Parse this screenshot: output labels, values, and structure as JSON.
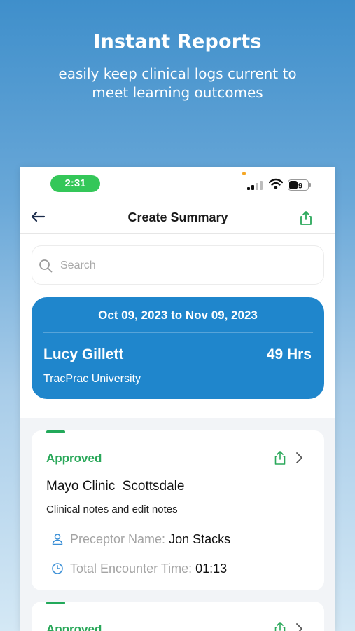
{
  "hero": {
    "title": "Instant Reports",
    "subtitle_line1": "easily keep clinical logs current to",
    "subtitle_line2": "meet learning outcomes"
  },
  "status_bar": {
    "time": "2:31",
    "battery": "39"
  },
  "nav": {
    "title": "Create Summary"
  },
  "search": {
    "placeholder": "Search"
  },
  "summary": {
    "date_range": "Oct 09, 2023 to Nov 09, 2023",
    "name": "Lucy Gillett",
    "hours": "49 Hrs",
    "university": "TracPrac University"
  },
  "cards": [
    {
      "status": "Approved",
      "clinic": "Mayo Clinic  Scottsdale",
      "notes": "Clinical notes and edit notes",
      "preceptor_label": "Preceptor Name:",
      "preceptor_value": "Jon Stacks",
      "time_label": "Total Encounter Time:",
      "time_value": "01:13"
    },
    {
      "status": "Approved"
    }
  ],
  "colors": {
    "primary_blue": "#1f86cc",
    "approved_green": "#2aa85a",
    "status_green": "#34c759"
  }
}
